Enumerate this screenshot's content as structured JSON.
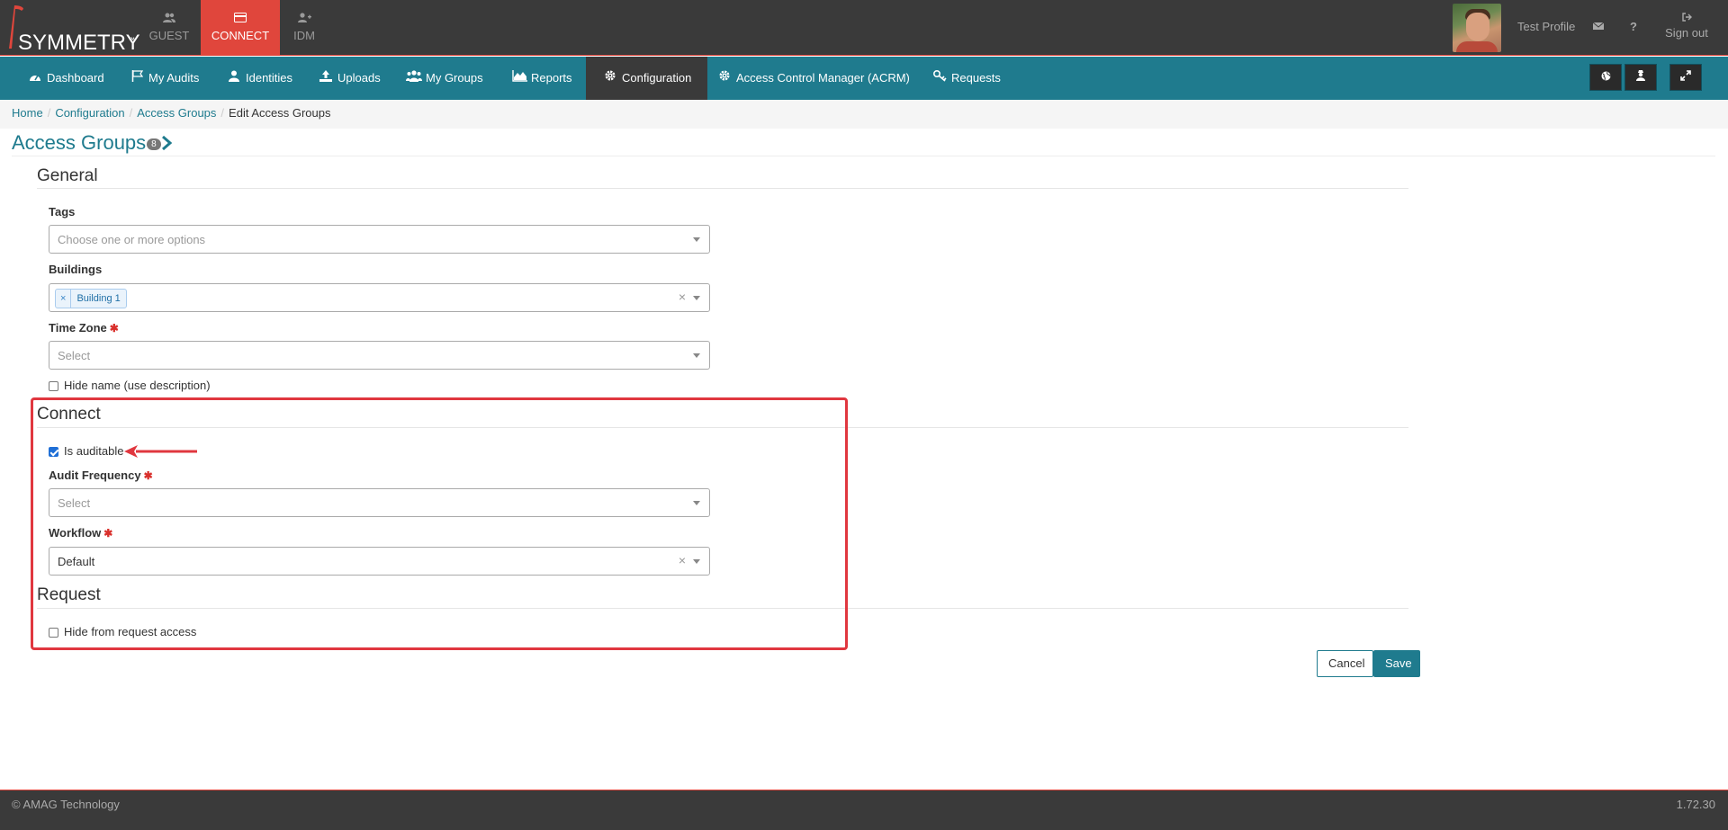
{
  "brand": {
    "name": "SYMMETRY",
    "tm": "™"
  },
  "app_tabs": [
    {
      "label": "GUEST",
      "icon": "users-icon"
    },
    {
      "label": "CONNECT",
      "icon": "card-icon"
    },
    {
      "label": "IDM",
      "icon": "user-plus-icon"
    }
  ],
  "user": {
    "profile_name": "Test Profile",
    "signout_label": "Sign out"
  },
  "nav": {
    "items": [
      {
        "label": "Dashboard",
        "icon": "dashboard-icon"
      },
      {
        "label": "My Audits",
        "icon": "flag-icon"
      },
      {
        "label": "Identities",
        "icon": "user-icon"
      },
      {
        "label": "Uploads",
        "icon": "upload-icon"
      },
      {
        "label": "My Groups",
        "icon": "group-icon"
      },
      {
        "label": "Reports",
        "icon": "area-chart-icon"
      },
      {
        "label": "Configuration",
        "icon": "gear-icon"
      },
      {
        "label": "Access Control Manager (ACRM)",
        "icon": "gear-icon"
      },
      {
        "label": "Requests",
        "icon": "key-icon"
      }
    ],
    "active": "Configuration"
  },
  "breadcrumb": {
    "home": "Home",
    "configuration": "Configuration",
    "access_groups": "Access Groups",
    "current": "Edit Access Groups"
  },
  "page": {
    "title": "Access Groups",
    "badge": "8"
  },
  "general": {
    "legend": "General",
    "tags_label": "Tags",
    "tags_placeholder": "Choose one or more options",
    "buildings_label": "Buildings",
    "buildings_selected": "Building 1",
    "timezone_label": "Time Zone",
    "timezone_placeholder": "Select",
    "hide_name_label": "Hide name (use description)"
  },
  "connect": {
    "legend": "Connect",
    "is_auditable_label": "Is auditable",
    "is_auditable_checked": true,
    "audit_frequency_label": "Audit Frequency",
    "audit_frequency_placeholder": "Select",
    "workflow_label": "Workflow",
    "workflow_value": "Default"
  },
  "request": {
    "legend": "Request",
    "hide_from_request_label": "Hide from request access"
  },
  "actions": {
    "cancel": "Cancel",
    "save": "Save"
  },
  "footer": {
    "copyright": "© AMAG Technology",
    "version": "1.72.30"
  },
  "colors": {
    "accent": "#1f7b8e",
    "brand_red": "#e0463c",
    "topbar": "#3a3a3a",
    "highlight": "#e0373f"
  }
}
